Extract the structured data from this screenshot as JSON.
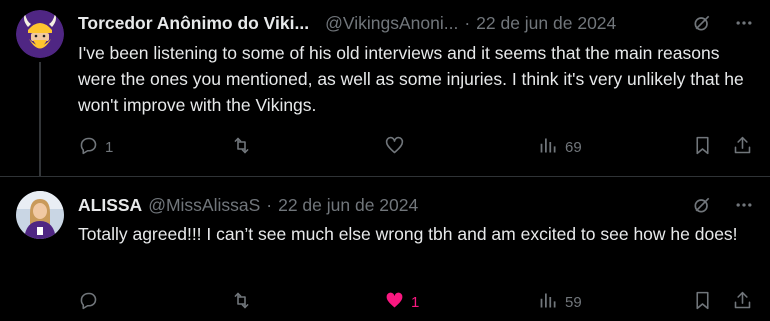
{
  "tweets": [
    {
      "author_name": "Torcedor Anônimo do Viki...",
      "handle": "@VikingsAnoni...",
      "separator": "·",
      "date": "22 de jun de 2024",
      "text": "I've been listening to some of his old interviews and it seems that the main reasons were the ones you mentioned, as well as some injuries. I think it's very unlikely that he won't improve with the Vikings.",
      "replies": "1",
      "views": "69"
    },
    {
      "author_name": "ALISSA",
      "handle": "@MissAlissaS",
      "separator": "·",
      "date": "22 de jun de 2024",
      "text": "Totally agreed!!! I can’t see much else wrong tbh and am excited to see how he does!",
      "likes": "1",
      "views": "59"
    }
  ],
  "icons": {
    "grok": "grok-icon",
    "more": "more-icon",
    "reply": "reply-icon",
    "retweet": "retweet-icon",
    "like": "heart-icon",
    "views": "views-icon",
    "bookmark": "bookmark-icon",
    "share": "share-icon"
  },
  "colors": {
    "background": "#000000",
    "text": "#e7e9ea",
    "muted": "#71767b",
    "like_active": "#f91880",
    "divider": "#2f3336"
  }
}
